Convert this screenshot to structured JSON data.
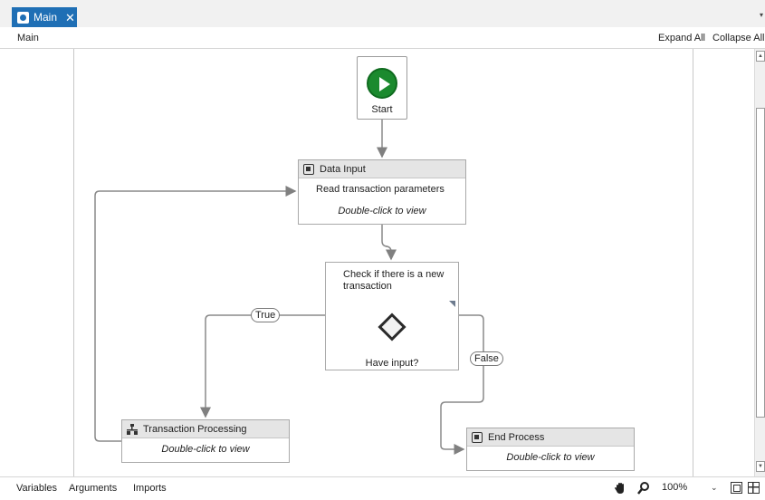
{
  "tabs": [
    {
      "label": "Main",
      "close_glyph": "✕"
    }
  ],
  "tab_dropdown_glyph": "▾",
  "breadcrumb": {
    "current": "Main"
  },
  "toolbar": {
    "expand_all": "Expand All",
    "collapse_all": "Collapse All"
  },
  "activities": {
    "start": {
      "label": "Start"
    },
    "data_input": {
      "title": "Data Input",
      "body": "Read transaction parameters",
      "hint": "Double-click to view"
    },
    "decision": {
      "title": "Check if there is a new transaction",
      "label": "Have input?",
      "true_label": "True",
      "false_label": "False"
    },
    "transaction_processing": {
      "title": "Transaction Processing",
      "hint": "Double-click to view"
    },
    "end_process": {
      "title": "End Process",
      "hint": "Double-click to view"
    }
  },
  "statusbar": {
    "variables": "Variables",
    "arguments": "Arguments",
    "imports": "Imports",
    "zoom": "100%",
    "zoom_dropdown_glyph": "⌄"
  },
  "icons": [
    "tab-icon",
    "close-icon",
    "play-icon",
    "activity-icon",
    "diamond-icon",
    "tree-icon",
    "hand-icon",
    "search-icon",
    "fit-to-screen-icon",
    "overview-icon"
  ],
  "colors": {
    "tab_active": "#1f6fb5",
    "start_green": "#1b8a2e",
    "header_gray": "#e5e5e5"
  }
}
